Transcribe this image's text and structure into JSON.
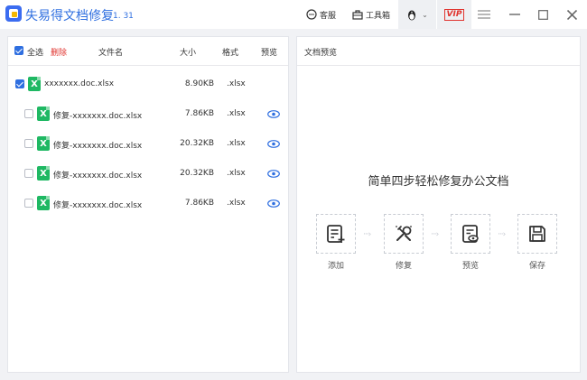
{
  "app": {
    "title": "失易得文档修复",
    "version": "1. 31"
  },
  "titlebar": {
    "service_label": "客服",
    "tools_label": "工具箱",
    "user_caret": "⌄",
    "vip_label": "VIP"
  },
  "list": {
    "select_all_label": "全选",
    "delete_label": "删除",
    "columns": {
      "name": "文件名",
      "size": "大小",
      "format": "格式",
      "preview": "预览"
    },
    "parent": {
      "name": "xxxxxxx.doc.xlsx",
      "size": "8.90KB",
      "format": ".xlsx",
      "checked": true
    },
    "children": [
      {
        "name": "修复-xxxxxxx.doc.xlsx",
        "size": "7.86KB",
        "format": ".xlsx",
        "checked": false
      },
      {
        "name": "修复-xxxxxxx.doc.xlsx",
        "size": "20.32KB",
        "format": ".xlsx",
        "checked": false
      },
      {
        "name": "修复-xxxxxxx.doc.xlsx",
        "size": "20.32KB",
        "format": ".xlsx",
        "checked": false
      },
      {
        "name": "修复-xxxxxxx.doc.xlsx",
        "size": "7.86KB",
        "format": ".xlsx",
        "checked": false
      }
    ],
    "file_icon_letter": "X"
  },
  "preview": {
    "panel_title": "文档预览",
    "headline": "简单四步轻松修复办公文档",
    "steps": [
      {
        "label": "添加",
        "icon": "add-doc-icon"
      },
      {
        "label": "修复",
        "icon": "repair-tools-icon"
      },
      {
        "label": "预览",
        "icon": "preview-doc-icon"
      },
      {
        "label": "保存",
        "icon": "save-icon"
      }
    ],
    "arrow_glyph": "···›"
  },
  "colors": {
    "accent": "#2f6fe0",
    "delete": "#e0342f",
    "excel_green": "#1fb863"
  }
}
